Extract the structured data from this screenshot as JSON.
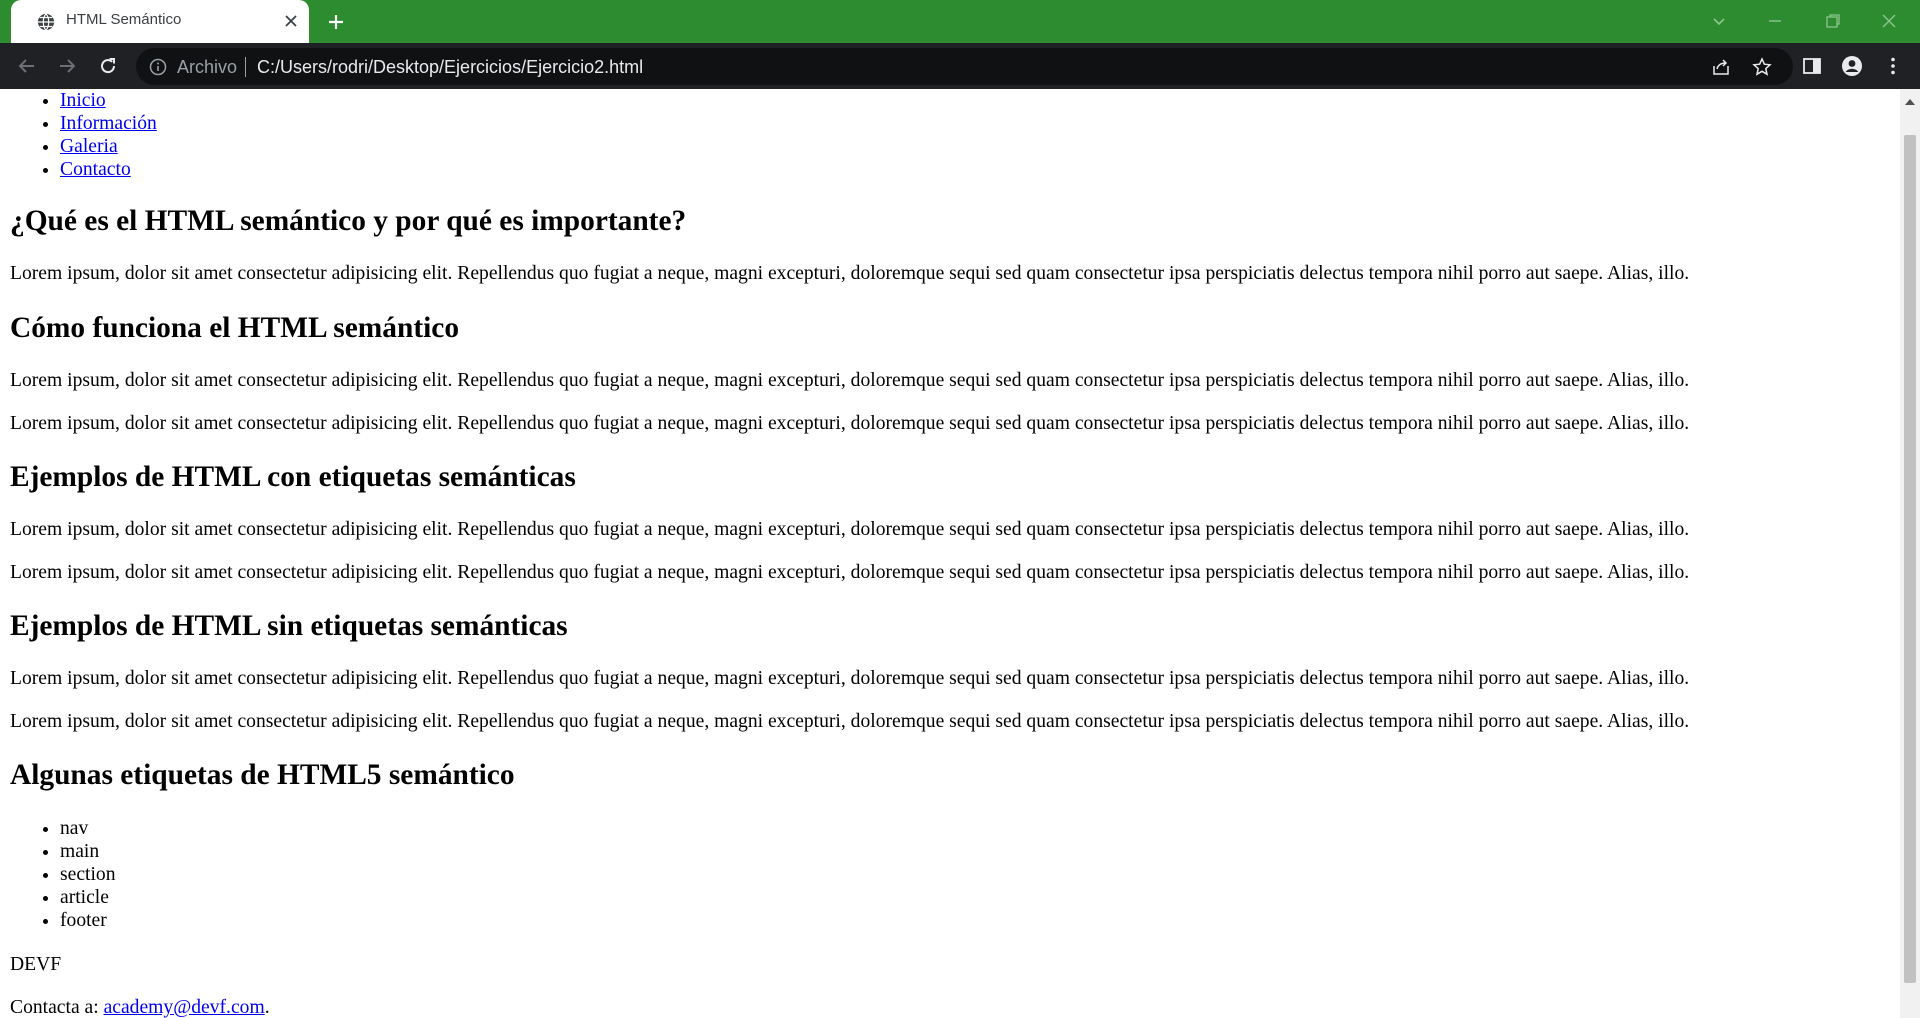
{
  "browser": {
    "tab_title": "HTML Semántico",
    "address_scheme_label": "Archivo",
    "address_url": "C:/Users/rodri/Desktop/Ejercicios/Ejercicio2.html",
    "colors": {
      "frame": "#2c8c2f",
      "toolbar": "#202124",
      "omnibox": "#101113"
    }
  },
  "page": {
    "nav": [
      "Inicio",
      "Información",
      "Galeria",
      "Contacto"
    ],
    "sections": [
      {
        "heading": "¿Qué es el HTML semántico y por qué es importante?",
        "paragraphs": [
          "Lorem ipsum, dolor sit amet consectetur adipisicing elit. Repellendus quo fugiat a neque, magni excepturi, doloremque sequi sed quam consectetur ipsa perspiciatis delectus tempora nihil porro aut saepe. Alias, illo."
        ]
      },
      {
        "heading": "Cómo funciona el HTML semántico",
        "paragraphs": [
          "Lorem ipsum, dolor sit amet consectetur adipisicing elit. Repellendus quo fugiat a neque, magni excepturi, doloremque sequi sed quam consectetur ipsa perspiciatis delectus tempora nihil porro aut saepe. Alias, illo.",
          "Lorem ipsum, dolor sit amet consectetur adipisicing elit. Repellendus quo fugiat a neque, magni excepturi, doloremque sequi sed quam consectetur ipsa perspiciatis delectus tempora nihil porro aut saepe. Alias, illo."
        ]
      },
      {
        "heading": "Ejemplos de HTML con etiquetas semánticas",
        "paragraphs": [
          "Lorem ipsum, dolor sit amet consectetur adipisicing elit. Repellendus quo fugiat a neque, magni excepturi, doloremque sequi sed quam consectetur ipsa perspiciatis delectus tempora nihil porro aut saepe. Alias, illo.",
          "Lorem ipsum, dolor sit amet consectetur adipisicing elit. Repellendus quo fugiat a neque, magni excepturi, doloremque sequi sed quam consectetur ipsa perspiciatis delectus tempora nihil porro aut saepe. Alias, illo."
        ]
      },
      {
        "heading": "Ejemplos de HTML sin etiquetas semánticas",
        "paragraphs": [
          "Lorem ipsum, dolor sit amet consectetur adipisicing elit. Repellendus quo fugiat a neque, magni excepturi, doloremque sequi sed quam consectetur ipsa perspiciatis delectus tempora nihil porro aut saepe. Alias, illo.",
          "Lorem ipsum, dolor sit amet consectetur adipisicing elit. Repellendus quo fugiat a neque, magni excepturi, doloremque sequi sed quam consectetur ipsa perspiciatis delectus tempora nihil porro aut saepe. Alias, illo."
        ]
      },
      {
        "heading": "Algunas etiquetas de HTML5 semántico",
        "paragraphs": []
      }
    ],
    "semantic_tags": [
      "nav",
      "main",
      "section",
      "article",
      "footer"
    ],
    "footer": {
      "brand": "DEVF",
      "contact_prefix": "Contacta a: ",
      "contact_email": "academy@devf.com",
      "contact_suffix": "."
    }
  }
}
